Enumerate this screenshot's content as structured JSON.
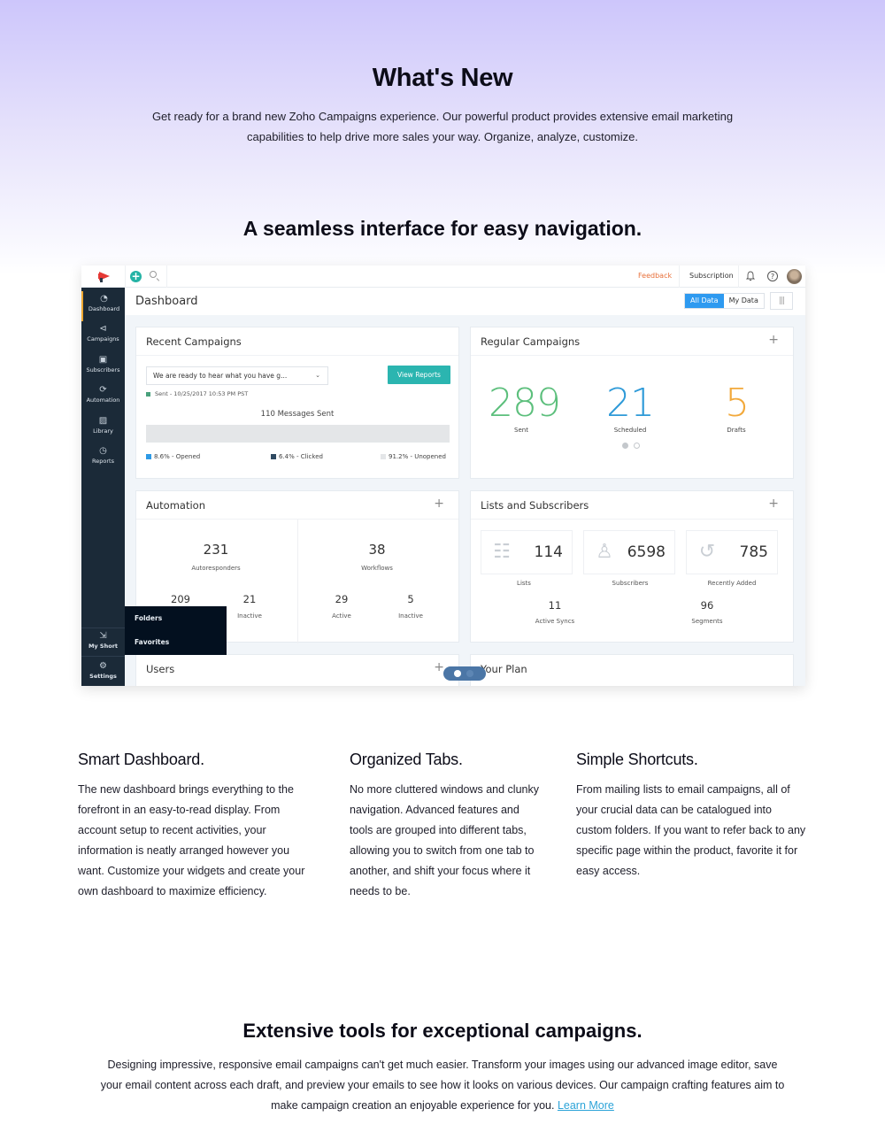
{
  "hero": {
    "title": "What's New",
    "description": "Get ready for a brand new Zoho Campaigns experience. Our powerful product provides extensive email marketing capabilities to help drive more sales your way. Organize, analyze, customize."
  },
  "section_title": "A seamless interface for easy navigation.",
  "mockup": {
    "topbar": {
      "logo_icon": "megaphone-icon",
      "add_icon": "plus-circle-icon",
      "search_icon": "search-icon",
      "feedback_label": "Feedback",
      "subscription_label": "Subscription",
      "bell_icon": "bell-icon",
      "help_icon": "help-icon",
      "help_glyph": "?",
      "avatar": "user-avatar"
    },
    "sidebar": {
      "items": [
        {
          "label": "Dashboard",
          "icon": "gauge-icon",
          "glyph": "◔",
          "active": true
        },
        {
          "label": "Campaigns",
          "icon": "megaphone-icon",
          "glyph": "⊲"
        },
        {
          "label": "Subscribers",
          "icon": "contact-card-icon",
          "glyph": "▣"
        },
        {
          "label": "Automation",
          "icon": "automation-icon",
          "glyph": "⟳"
        },
        {
          "label": "Library",
          "icon": "image-icon",
          "glyph": "▨"
        },
        {
          "label": "Reports",
          "icon": "pie-chart-icon",
          "glyph": "◷"
        }
      ],
      "bottom_items": [
        {
          "label": "My Short",
          "icon": "shortcut-icon",
          "glyph": "⇲"
        },
        {
          "label": "Settings",
          "icon": "gear-icon",
          "glyph": "⚙"
        }
      ],
      "flyout": [
        "Folders",
        "Favorites"
      ]
    },
    "header": {
      "title": "Dashboard",
      "toggle_all": "All Data",
      "toggle_my": "My Data",
      "settings_glyph": "|||"
    },
    "recent_campaigns": {
      "title": "Recent Campaigns",
      "selected_campaign": "We are ready to hear what you have g...",
      "view_reports_label": "View Reports",
      "sent_status": "Sent - 10/25/2017 10:53 PM PST",
      "messages_sent": "110 Messages Sent",
      "stats": [
        {
          "label": "8.6% - Opened",
          "percent": 8.6,
          "color": "#2e9ae6"
        },
        {
          "label": "6.4% - Clicked",
          "percent": 6.4,
          "color": "#2f4a62"
        },
        {
          "label": "91.2% - Unopened",
          "percent": 91.2,
          "color": "#e4e6e8"
        }
      ]
    },
    "regular_campaigns": {
      "title": "Regular Campaigns",
      "plus": "+",
      "stats": [
        {
          "value": "289",
          "label": "Sent",
          "color": "#5cbf7c"
        },
        {
          "value": "21",
          "label": "Scheduled",
          "color": "#2e9ad8"
        },
        {
          "value": "5",
          "label": "Drafts",
          "color": "#f2a93b"
        }
      ],
      "page_dots": {
        "active": 1,
        "total": 2
      }
    },
    "automation": {
      "title": "Automation",
      "plus": "+",
      "autoresponders": {
        "value": "231",
        "label": "Autoresponders",
        "active": "209",
        "inactive": "21",
        "inactive_label": "Inactive"
      },
      "workflows": {
        "value": "38",
        "label": "Workflows",
        "active": "29",
        "active_label": "Active",
        "inactive": "5",
        "inactive_label": "Inactive"
      }
    },
    "lists_subscribers": {
      "title": "Lists and Subscribers",
      "plus": "+",
      "boxes": [
        {
          "value": "114",
          "label": "Lists",
          "icon": "contact-list-icon",
          "glyph": "☷"
        },
        {
          "value": "6598",
          "label": "Subscribers",
          "icon": "person-icon",
          "glyph": "♙"
        },
        {
          "value": "785",
          "label": "Recently Added",
          "icon": "history-icon",
          "glyph": "↺"
        }
      ],
      "extra": [
        {
          "value": "11",
          "label": "Active Syncs"
        },
        {
          "value": "96",
          "label": "Segments"
        }
      ]
    },
    "users": {
      "title": "Users",
      "plus": "+"
    },
    "your_plan": {
      "title": "Your Plan"
    },
    "carousel": {
      "active": 1,
      "total": 2
    }
  },
  "features": [
    {
      "title": "Smart Dashboard.",
      "text": "The new dashboard brings everything to the forefront in an easy-to-read display. From account setup to recent activities, your information is neatly arranged however you want. Customize your widgets and create your own dashboard to maximize efficiency."
    },
    {
      "title": "Organized Tabs.",
      "text": "No more cluttered windows and clunky navigation. Advanced features and tools are grouped into different tabs, allowing you to switch from one tab to another, and shift your focus where it needs to be."
    },
    {
      "title": "Simple Shortcuts.",
      "text": "From mailing lists to email campaigns, all of your crucial data can be catalogued into custom folders. If you want to refer back to any specific page within the product, favorite it for easy access."
    }
  ],
  "tools": {
    "title": "Extensive tools for exceptional campaigns.",
    "description": "Designing impressive, responsive email campaigns can't get much easier. Transform your images using our advanced image editor, save your email content across each draft, and preview your emails to see how it looks on various devices. Our campaign crafting features aim to make campaign creation an enjoyable experience for you. ",
    "link_label": "Learn More",
    "link_color": "#2ba3d8"
  }
}
